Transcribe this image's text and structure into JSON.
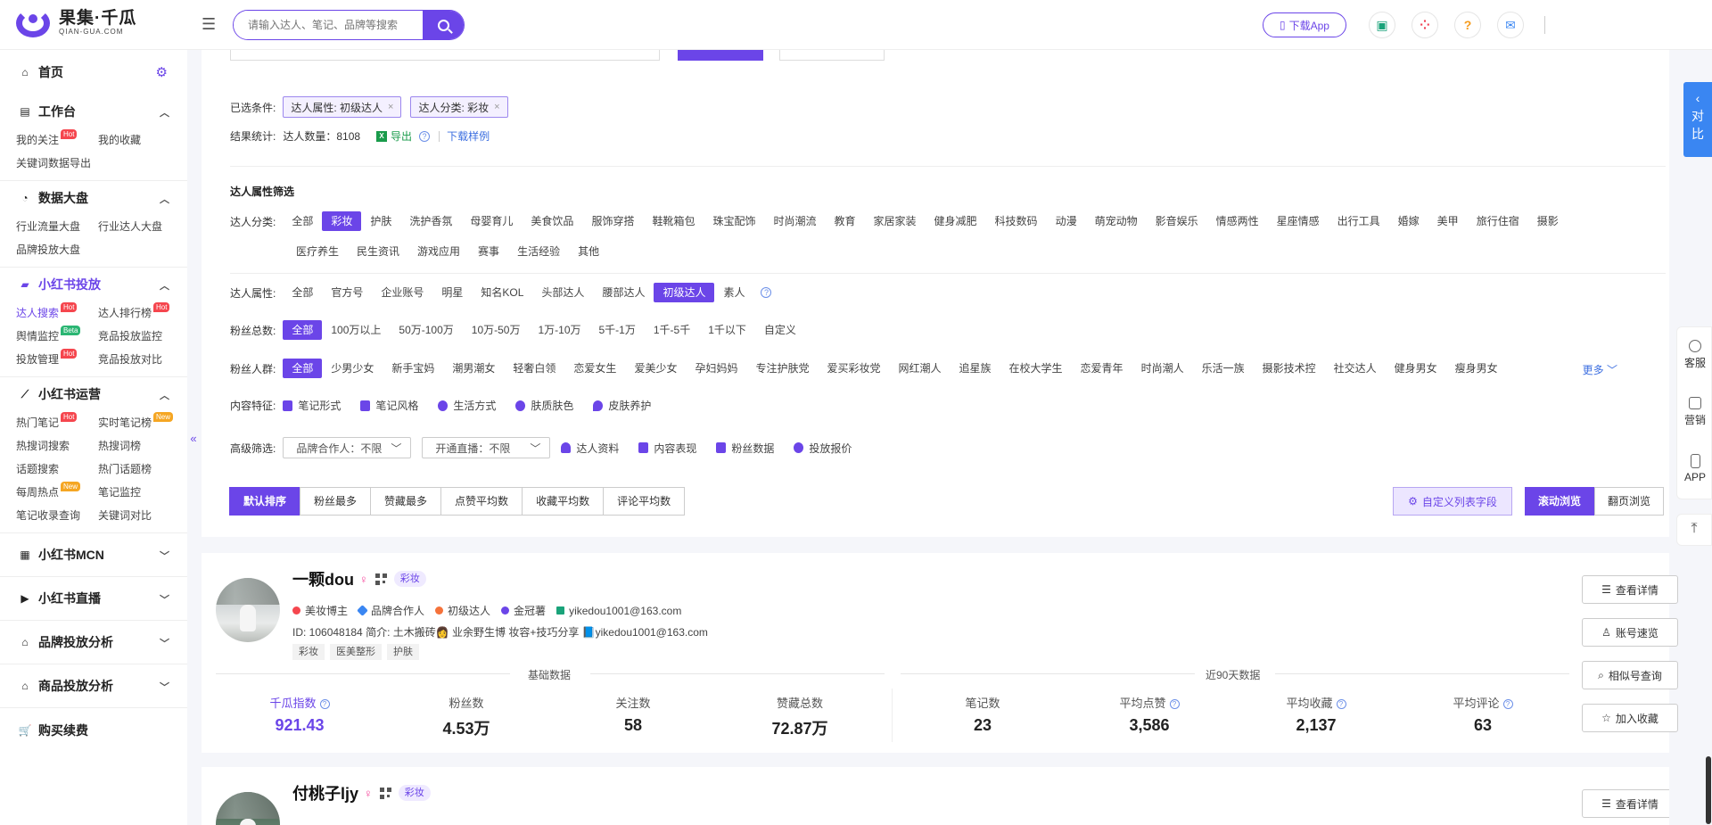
{
  "header": {
    "logo_title": "果集·千瓜",
    "logo_sub": "QIAN-GUA.COM",
    "search_placeholder": "请输入达人、笔记、品牌等搜索",
    "download_app": "下载App",
    "help": "?"
  },
  "sidebar": {
    "home": "首页",
    "sections": [
      {
        "title": "工作台",
        "items": [
          {
            "label": "我的关注",
            "badge": "Hot"
          },
          {
            "label": "我的收藏",
            "badge": ""
          },
          {
            "label": "关键词数据导出",
            "badge": ""
          }
        ]
      },
      {
        "title": "数据大盘",
        "items": [
          {
            "label": "行业流量大盘",
            "badge": ""
          },
          {
            "label": "行业达人大盘",
            "badge": ""
          },
          {
            "label": "品牌投放大盘",
            "badge": ""
          }
        ]
      },
      {
        "title": "小红书投放",
        "items": [
          {
            "label": "达人搜索",
            "badge": "Hot"
          },
          {
            "label": "达人排行榜",
            "badge": "Hot"
          },
          {
            "label": "舆情监控",
            "badge": "Beta"
          },
          {
            "label": "竞品投放监控",
            "badge": ""
          },
          {
            "label": "投放管理",
            "badge": "Hot"
          },
          {
            "label": "竞品投放对比",
            "badge": ""
          }
        ]
      },
      {
        "title": "小红书运营",
        "items": [
          {
            "label": "热门笔记",
            "badge": "Hot"
          },
          {
            "label": "实时笔记榜",
            "badge": "New"
          },
          {
            "label": "热搜词搜索",
            "badge": ""
          },
          {
            "label": "热搜词榜",
            "badge": ""
          },
          {
            "label": "话题搜索",
            "badge": ""
          },
          {
            "label": "热门话题榜",
            "badge": ""
          },
          {
            "label": "每周热点",
            "badge": "New"
          },
          {
            "label": "笔记监控",
            "badge": ""
          },
          {
            "label": "笔记收录查询",
            "badge": ""
          },
          {
            "label": "关键词对比",
            "badge": ""
          }
        ]
      }
    ],
    "collapsed": [
      "小红书MCN",
      "小红书直播",
      "品牌投放分析",
      "商品投放分析"
    ],
    "renew": "购买续费"
  },
  "filters": {
    "selected_label": "已选条件:",
    "selected": [
      "达人属性: 初级达人",
      "达人分类: 彩妆"
    ],
    "result_label": "结果统计:",
    "result_count": "达人数量：8108",
    "export": "导出",
    "sample": "下载样例",
    "section_title": "达人属性筛选",
    "category_label": "达人分类:",
    "categories_row1": [
      "全部",
      "彩妆",
      "护肤",
      "洗护香氛",
      "母婴育儿",
      "美食饮品",
      "服饰穿搭",
      "鞋靴箱包",
      "珠宝配饰",
      "时尚潮流",
      "教育",
      "家居家装",
      "健身减肥",
      "科技数码",
      "动漫",
      "萌宠动物",
      "影音娱乐",
      "情感两性",
      "星座情感",
      "出行工具",
      "婚嫁",
      "美甲",
      "旅行住宿",
      "摄影"
    ],
    "categories_row2": [
      "医疗养生",
      "民生资讯",
      "游戏应用",
      "赛事",
      "生活经验",
      "其他"
    ],
    "attr_label": "达人属性:",
    "attrs": [
      "全部",
      "官方号",
      "企业账号",
      "明星",
      "知名KOL",
      "头部达人",
      "腰部达人",
      "初级达人",
      "素人"
    ],
    "fans_label": "粉丝总数:",
    "fans": [
      "全部",
      "100万以上",
      "50万-100万",
      "10万-50万",
      "1万-10万",
      "5千-1万",
      "1千-5千",
      "1千以下",
      "自定义"
    ],
    "crowd_label": "粉丝人群:",
    "crowds": [
      "全部",
      "少男少女",
      "新手宝妈",
      "潮男潮女",
      "轻奢白领",
      "恋爱女生",
      "爱美少女",
      "孕妇妈妈",
      "专注护肤党",
      "爱买彩妆党",
      "网红潮人",
      "追星族",
      "在校大学生",
      "恋爱青年",
      "时尚潮人",
      "乐活一族",
      "摄影技术控",
      "社交达人",
      "健身男女",
      "瘦身男女"
    ],
    "more": "更多",
    "content_label": "内容特征:",
    "content": [
      "笔记形式",
      "笔记风格",
      "生活方式",
      "肤质肤色",
      "皮肤养护"
    ],
    "adv_label": "高级筛选:",
    "dropdowns": [
      "品牌合作人：不限",
      "开通直播：不限"
    ],
    "adv_links": [
      "达人资料",
      "内容表现",
      "粉丝数据",
      "投放报价"
    ],
    "sorts": [
      "默认排序",
      "粉丝最多",
      "赞藏最多",
      "点赞平均数",
      "收藏平均数",
      "评论平均数"
    ],
    "custom_fields": "自定义列表字段",
    "views": [
      "滚动浏览",
      "翻页浏览"
    ]
  },
  "cards": [
    {
      "name": "一颗dou",
      "category": "彩妆",
      "attrs": [
        "美妆博主",
        "品牌合作人",
        "初级达人",
        "金冠薯",
        "yikedou1001@163.com"
      ],
      "id_line": "ID: 106048184  简介: 土木搬砖👩 业余野生博 妆容+技巧分享 📘yikedou1001@163.com",
      "tags": [
        "彩妆",
        "医美整形",
        "护肤"
      ],
      "basic_title": "基础数据",
      "recent_title": "近90天数据",
      "stats": [
        {
          "label": "千瓜指数",
          "value": "921.43"
        },
        {
          "label": "粉丝数",
          "value": "4.53万"
        },
        {
          "label": "关注数",
          "value": "58"
        },
        {
          "label": "赞藏总数",
          "value": "72.87万"
        },
        {
          "label": "笔记数",
          "value": "23"
        },
        {
          "label": "平均点赞",
          "value": "3,586"
        },
        {
          "label": "平均收藏",
          "value": "2,137"
        },
        {
          "label": "平均评论",
          "value": "63"
        }
      ],
      "actions": [
        "查看详情",
        "账号速览",
        "相似号查询",
        "加入收藏"
      ]
    },
    {
      "name": "付桃子ljy",
      "category": "彩妆",
      "actions": [
        "查看详情"
      ]
    }
  ],
  "right": {
    "compare": [
      "对",
      "比"
    ],
    "tools": [
      "客服",
      "营销",
      "APP"
    ]
  }
}
